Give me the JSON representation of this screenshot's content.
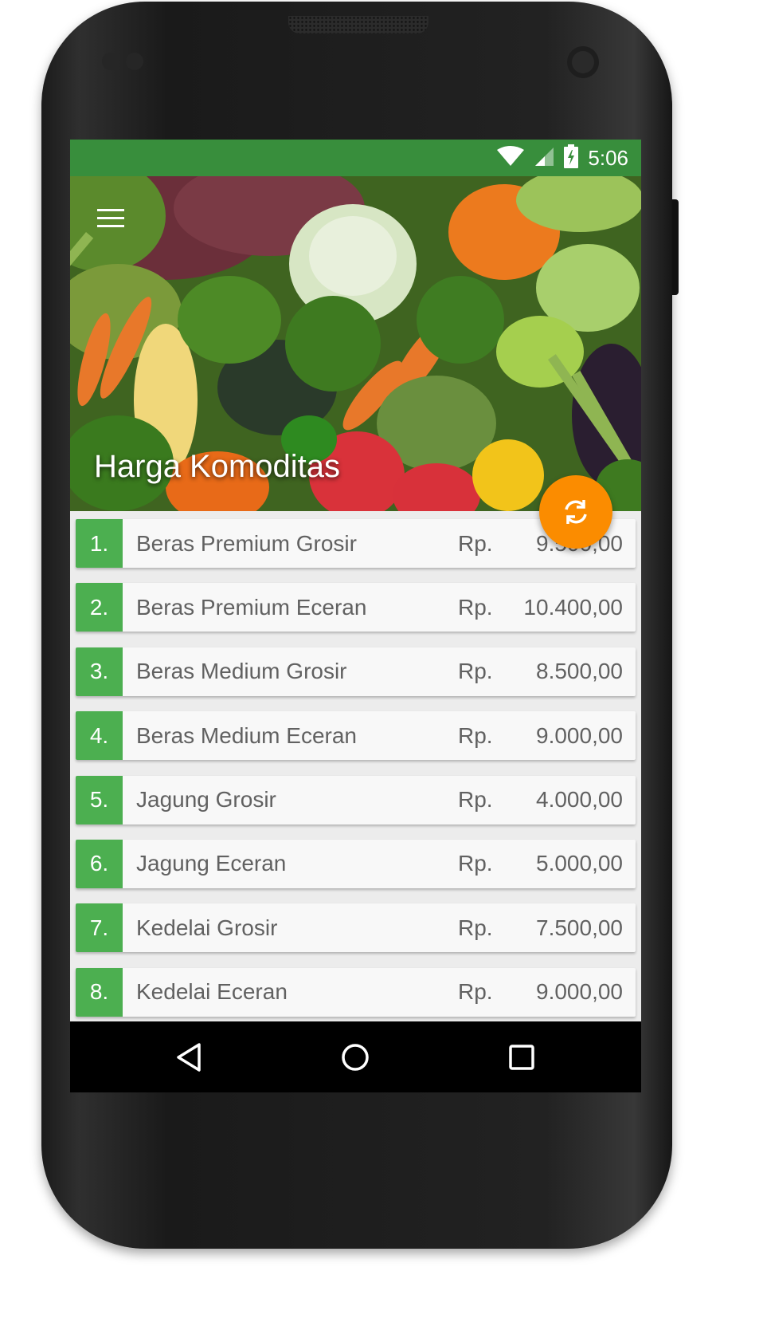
{
  "status_bar": {
    "time": "5:06",
    "icons": [
      "wifi-icon",
      "signal-icon",
      "battery-charging-icon"
    ]
  },
  "header": {
    "title": "Harga Komoditas",
    "menu_icon": "hamburger-menu-icon",
    "background": "vegetables-photo"
  },
  "fab": {
    "icon": "refresh-icon",
    "color": "#fb8c00"
  },
  "colors": {
    "status_bar": "#388e3c",
    "number_badge": "#4caf50",
    "text": "#616161"
  },
  "commodities": [
    {
      "number": "1.",
      "name": "Beras Premium Grosir",
      "currency": "Rp.",
      "price": "9.500,00"
    },
    {
      "number": "2.",
      "name": "Beras Premium Eceran",
      "currency": "Rp.",
      "price": "10.400,00"
    },
    {
      "number": "3.",
      "name": "Beras Medium Grosir",
      "currency": "Rp.",
      "price": "8.500,00"
    },
    {
      "number": "4.",
      "name": "Beras Medium Eceran",
      "currency": "Rp.",
      "price": "9.000,00"
    },
    {
      "number": "5.",
      "name": "Jagung Grosir",
      "currency": "Rp.",
      "price": "4.000,00"
    },
    {
      "number": "6.",
      "name": "Jagung Eceran",
      "currency": "Rp.",
      "price": "5.000,00"
    },
    {
      "number": "7.",
      "name": "Kedelai Grosir",
      "currency": "Rp.",
      "price": "7.500,00"
    },
    {
      "number": "8.",
      "name": "Kedelai Eceran",
      "currency": "Rp.",
      "price": "9.000,00"
    }
  ],
  "nav_bar": {
    "buttons": [
      "back-icon",
      "home-icon",
      "recents-icon"
    ]
  }
}
